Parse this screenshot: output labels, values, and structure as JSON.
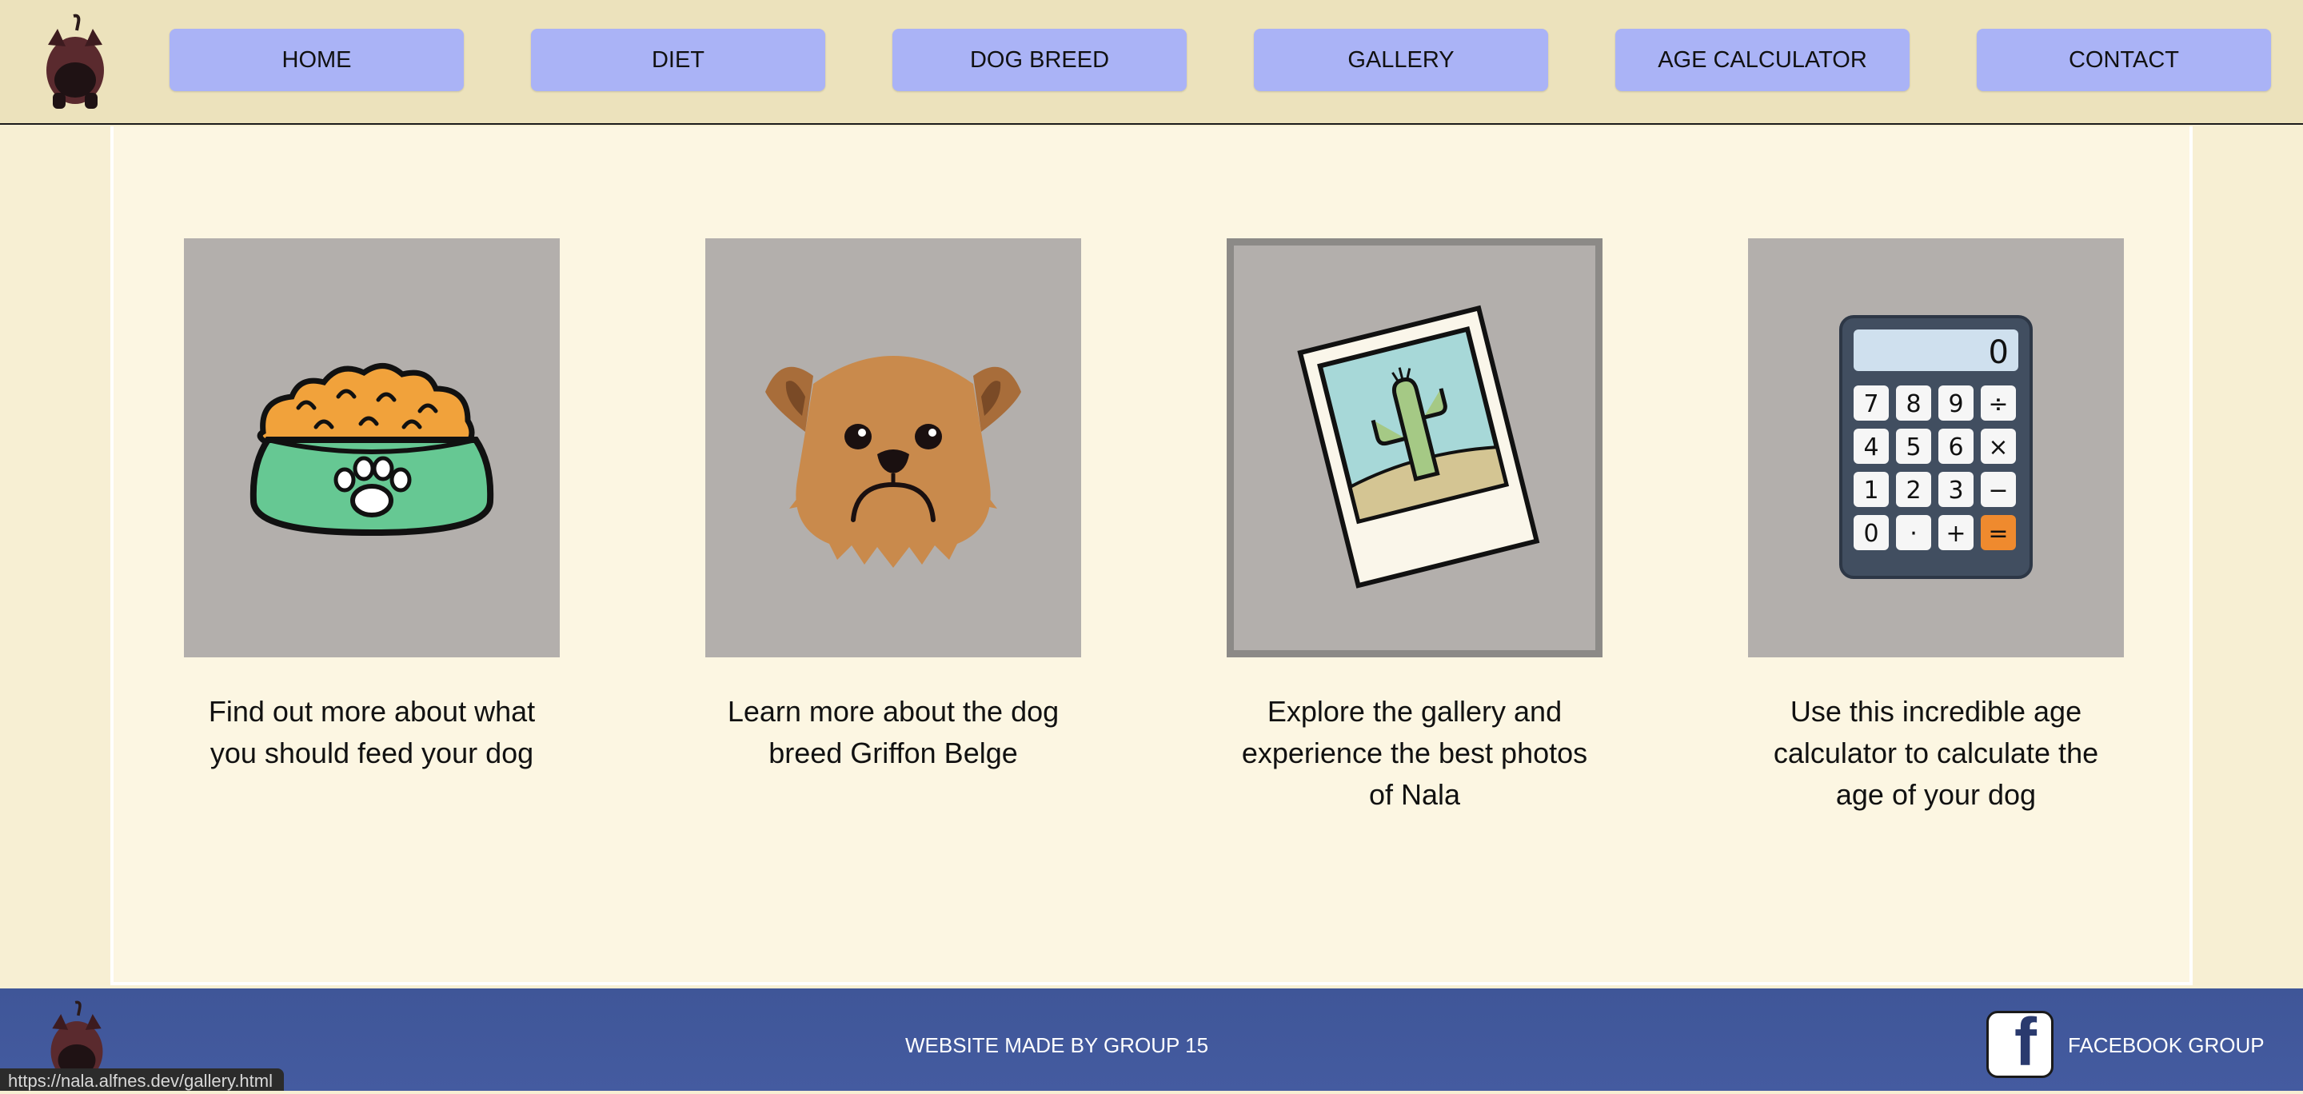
{
  "nav": {
    "home": "HOME",
    "diet": "DIET",
    "dog_breed": "DOG BREED",
    "gallery": "GALLERY",
    "age_calculator": "AGE CALCULATOR",
    "contact": "CONTACT"
  },
  "cards": [
    {
      "icon": "dog-food-bowl-icon",
      "text": "Find out more about what you should feed your dog"
    },
    {
      "icon": "griffon-dog-face-icon",
      "text": "Learn more about the dog breed Griffon Belge"
    },
    {
      "icon": "polaroid-photo-icon",
      "text": "Explore the gallery and experience the best photos of Nala"
    },
    {
      "icon": "calculator-icon",
      "text": "Use this incredible age calculator to calculate the age of your dog"
    }
  ],
  "calculator_display": "0",
  "calculator_keys": [
    "7",
    "8",
    "9",
    "÷",
    "4",
    "5",
    "6",
    "×",
    "1",
    "2",
    "3",
    "−",
    "0",
    "·",
    "+",
    "="
  ],
  "footer": {
    "credit": "WEBSITE MADE BY GROUP 15",
    "facebook_label": "FACEBOOK GROUP",
    "facebook_glyph": "f"
  },
  "status_bar_url": "https://nala.alfnes.dev/gallery.html",
  "colors": {
    "header_bg": "#ece2bc",
    "nav_button": "#aab3f6",
    "main_bg": "#fcf6e2",
    "card_bg": "#b3afac",
    "footer_bg": "#3f5698"
  }
}
